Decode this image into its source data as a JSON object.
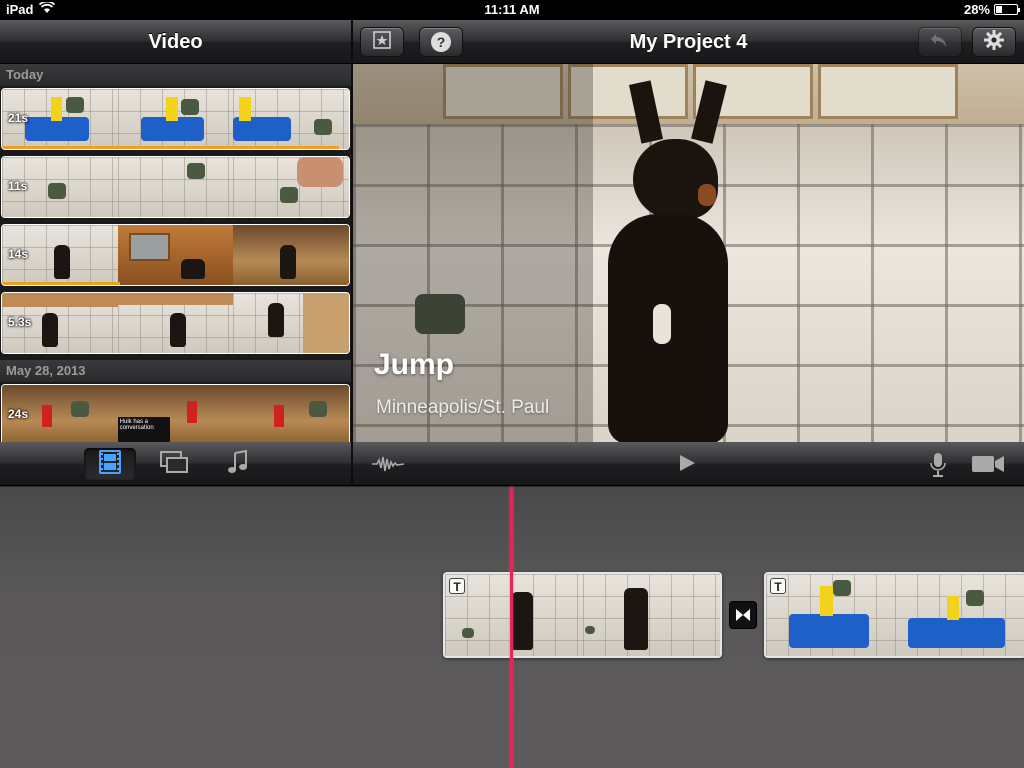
{
  "status_bar": {
    "device": "iPad",
    "time": "11:11 AM",
    "battery": "28%",
    "battery_level": 0.28
  },
  "browser": {
    "title": "Video",
    "sections": [
      {
        "label": "Today",
        "clips": [
          {
            "duration": "21s"
          },
          {
            "duration": "11s"
          },
          {
            "duration": "14s"
          },
          {
            "duration": "5.3s"
          }
        ]
      },
      {
        "label": "May 28, 2013",
        "clips": [
          {
            "duration": "24s",
            "caption": "Hulk has a conversation"
          }
        ]
      }
    ],
    "tabs": [
      {
        "icon": "film-strip-icon",
        "active": true
      },
      {
        "icon": "photos-icon",
        "active": false
      },
      {
        "icon": "music-note-icon",
        "active": false
      }
    ]
  },
  "project": {
    "title": "My Project 4",
    "help_label": "?",
    "overlay_title": "Jump",
    "overlay_subtitle": "Minneapolis/St. Paul"
  },
  "timeline": {
    "title_badge": "T"
  },
  "colors": {
    "playhead": "#e3265a",
    "accent_blue": "#4aa3ff",
    "used_marker": "#f0a020"
  }
}
